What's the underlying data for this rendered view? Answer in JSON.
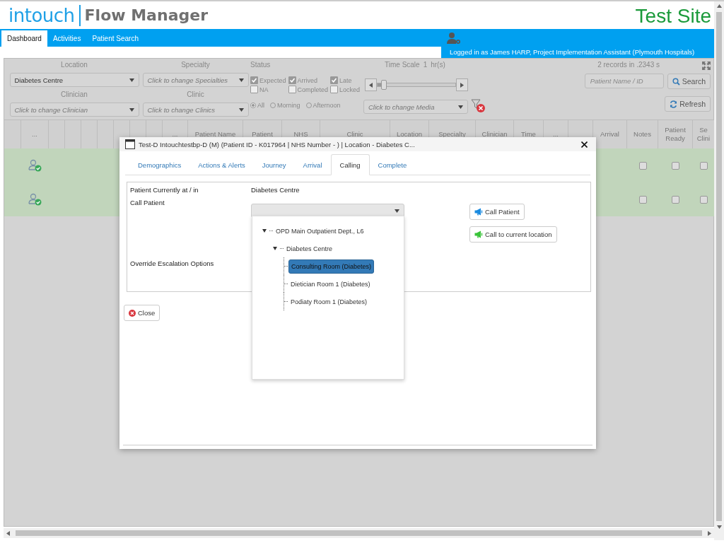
{
  "header": {
    "brand": "intouch",
    "product": "Flow Manager",
    "site_label": "Test Site"
  },
  "nav": {
    "tabs": [
      {
        "label": "Dashboard",
        "selected": true
      },
      {
        "label": "Activities",
        "selected": false
      },
      {
        "label": "Patient Search",
        "selected": false
      }
    ],
    "user_status": "Logged in as James HARP, Project Implementation Assistant (Plymouth Hospitals)"
  },
  "filters": {
    "location": {
      "label": "Location",
      "value": "Diabetes Centre"
    },
    "specialty": {
      "label": "Specialty",
      "placeholder": "Click to change Specialties"
    },
    "clinician": {
      "label": "Clinician",
      "placeholder": "Click to change Clinician"
    },
    "clinic": {
      "label": "Clinic",
      "placeholder": "Click to change Clinics"
    },
    "status": {
      "label": "Status",
      "options": [
        {
          "label": "Expected",
          "checked": true
        },
        {
          "label": "Arrived",
          "checked": true
        },
        {
          "label": "Late",
          "checked": true
        },
        {
          "label": "NA",
          "checked": false
        },
        {
          "label": "Completed",
          "checked": false
        },
        {
          "label": "Locked",
          "checked": false
        }
      ]
    },
    "session": [
      {
        "label": "All",
        "selected": true
      },
      {
        "label": "Morning",
        "selected": false
      },
      {
        "label": "Afternoon",
        "selected": false
      }
    ],
    "time_scale": {
      "label": "Time Scale",
      "value": "1",
      "unit": "hr(s)",
      "level": 0.05
    },
    "media": {
      "placeholder": "Click to change Media"
    },
    "records": "2 records in .2343 s",
    "patient_search": {
      "placeholder": "Patient Name / ID"
    },
    "search_button": "Search",
    "refresh_button": "Refresh"
  },
  "table": {
    "columns": [
      {
        "kind": "blank"
      },
      {
        "kind": "text",
        "label": "..."
      },
      {
        "kind": "blank"
      },
      {
        "kind": "blank"
      },
      {
        "kind": "blank"
      },
      {
        "kind": "blank"
      },
      {
        "kind": "blank"
      },
      {
        "kind": "blank"
      },
      {
        "kind": "blank"
      },
      {
        "kind": "text",
        "label": "..."
      },
      {
        "kind": "text",
        "label": "Patient Name"
      },
      {
        "kind": "text",
        "label": "Patient"
      },
      {
        "kind": "text",
        "label": "NHS"
      },
      {
        "kind": "text",
        "label": "Clinic"
      },
      {
        "kind": "text",
        "label": "Location"
      },
      {
        "kind": "text",
        "label": "Specialty"
      },
      {
        "kind": "text",
        "label": "Clinician"
      },
      {
        "kind": "text",
        "label": "Time"
      },
      {
        "kind": "text",
        "label": "..."
      },
      {
        "kind": "blank"
      },
      {
        "kind": "text",
        "label": "Arrival"
      },
      {
        "kind": "text",
        "label": "Notes"
      },
      {
        "kind": "text",
        "label": "Patient Ready"
      },
      {
        "kind": "text",
        "label": "Se Clini"
      }
    ],
    "rows": [
      {
        "notes": false,
        "patient_ready": false,
        "column_24": false
      },
      {
        "notes": false,
        "patient_ready": false,
        "column_24": false
      }
    ]
  },
  "dialog": {
    "title": "Test-D Intouchtestbp-D (M) (Patient ID - K017964 | NHS Number - ) | Location - Diabetes C...",
    "tabs": [
      {
        "label": "Demographics",
        "selected": false
      },
      {
        "label": "Actions & Alerts",
        "selected": false
      },
      {
        "label": "Journey",
        "selected": false
      },
      {
        "label": "Arrival",
        "selected": false
      },
      {
        "label": "Calling",
        "selected": true
      },
      {
        "label": "Complete",
        "selected": false
      }
    ],
    "current_location": {
      "label": "Patient Currently at / in",
      "value": "Diabetes Centre"
    },
    "call_patient_label": "Call Patient",
    "override_label": "Override Escalation Options",
    "call_buttons": [
      {
        "label": "Call Patient",
        "kind": "call"
      },
      {
        "label": "Call to current location",
        "kind": "current"
      }
    ],
    "location_tree": [
      {
        "label": "OPD Main Outpatient Dept., L6",
        "expanded": true,
        "selected": false,
        "children": [
          {
            "label": "Diabetes Centre",
            "expanded": true,
            "selected": false,
            "children": [
              {
                "label": "Consulting Room (Diabetes)",
                "selected": true
              },
              {
                "label": "Dietician Room 1 (Diabetes)",
                "selected": false
              },
              {
                "label": "Podiaty Room 1 (Diabetes)",
                "selected": false
              }
            ]
          }
        ]
      }
    ],
    "close_button": "Close"
  }
}
